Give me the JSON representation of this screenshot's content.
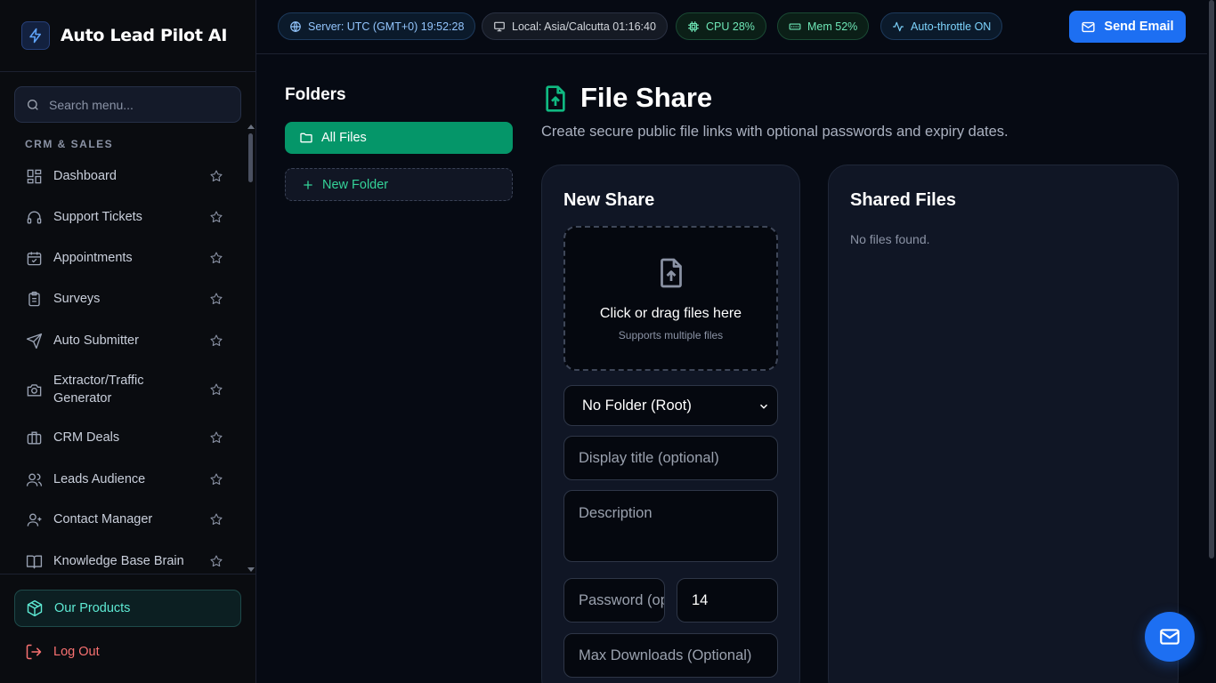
{
  "app": {
    "name": "Auto Lead Pilot AI"
  },
  "sidebar": {
    "search_placeholder": "Search menu...",
    "section": "CRM & SALES",
    "items": [
      {
        "label": "Dashboard",
        "icon": "dashboard-icon"
      },
      {
        "label": "Support Tickets",
        "icon": "headset-icon"
      },
      {
        "label": "Appointments",
        "icon": "calendar-check-icon"
      },
      {
        "label": "Surveys",
        "icon": "clipboard-icon"
      },
      {
        "label": "Auto Submitter",
        "icon": "send-icon"
      },
      {
        "label": "Extractor/Traffic Generator",
        "icon": "camera-icon"
      },
      {
        "label": "CRM Deals",
        "icon": "briefcase-icon"
      },
      {
        "label": "Leads Audience",
        "icon": "users-icon"
      },
      {
        "label": "Contact Manager",
        "icon": "user-group-icon"
      },
      {
        "label": "Knowledge Base Brain",
        "icon": "book-open-icon"
      }
    ],
    "products_label": "Our Products",
    "logout_label": "Log Out"
  },
  "topbar": {
    "server": "Server: UTC (GMT+0) 19:52:28",
    "local": "Local: Asia/Calcutta 01:16:40",
    "cpu": "CPU 28%",
    "mem": "Mem 52%",
    "throttle": "Auto-throttle ON",
    "send_email": "Send Email"
  },
  "folders": {
    "title": "Folders",
    "all_files": "All Files",
    "new_folder": "New Folder"
  },
  "page": {
    "title": "File Share",
    "subtitle": "Create secure public file links with optional passwords and expiry dates."
  },
  "new_share": {
    "title": "New Share",
    "dropzone_main": "Click or drag files here",
    "dropzone_sub": "Supports multiple files",
    "folder_select": "No Folder (Root)",
    "title_placeholder": "Display title (optional)",
    "description_placeholder": "Description",
    "password_placeholder": "Password (optional)",
    "expiry_value": "14",
    "max_downloads_placeholder": "Max Downloads (Optional)"
  },
  "shared_files": {
    "title": "Shared Files",
    "empty": "No files found."
  },
  "colors": {
    "accent": "#1d6ff2",
    "success": "#059669",
    "danger": "#f87171",
    "teal": "#5eead4"
  }
}
